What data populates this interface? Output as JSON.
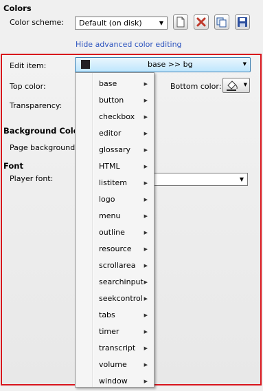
{
  "colors_section": {
    "heading": "Colors",
    "scheme_label": "Color scheme:",
    "scheme_value": "Default (on disk)",
    "toggle_link": "Hide advanced color editing",
    "toolbar_icons": [
      "new-file-icon",
      "delete-icon",
      "copy-icon",
      "save-icon"
    ]
  },
  "editor": {
    "edit_item_label": "Edit item:",
    "edit_item_value": "base >> bg",
    "top_color_label": "Top color:",
    "bottom_color_label": "Bottom color:",
    "transparency_label": "Transparency:"
  },
  "background_section": {
    "heading": "Background Color",
    "page_background_label": "Page background:"
  },
  "font_section": {
    "heading": "Font",
    "player_font_label": "Player font:"
  },
  "menu": {
    "items": [
      "base",
      "button",
      "checkbox",
      "editor",
      "glossary",
      "HTML",
      "listitem",
      "logo",
      "menu",
      "outline",
      "resource",
      "scrollarea",
      "searchinput",
      "seekcontrol",
      "tabs",
      "timer",
      "transcript",
      "volume",
      "window"
    ]
  },
  "colors": {
    "highlight_border": "#d8141c",
    "link": "#2a52be",
    "swatch": "#222222"
  }
}
